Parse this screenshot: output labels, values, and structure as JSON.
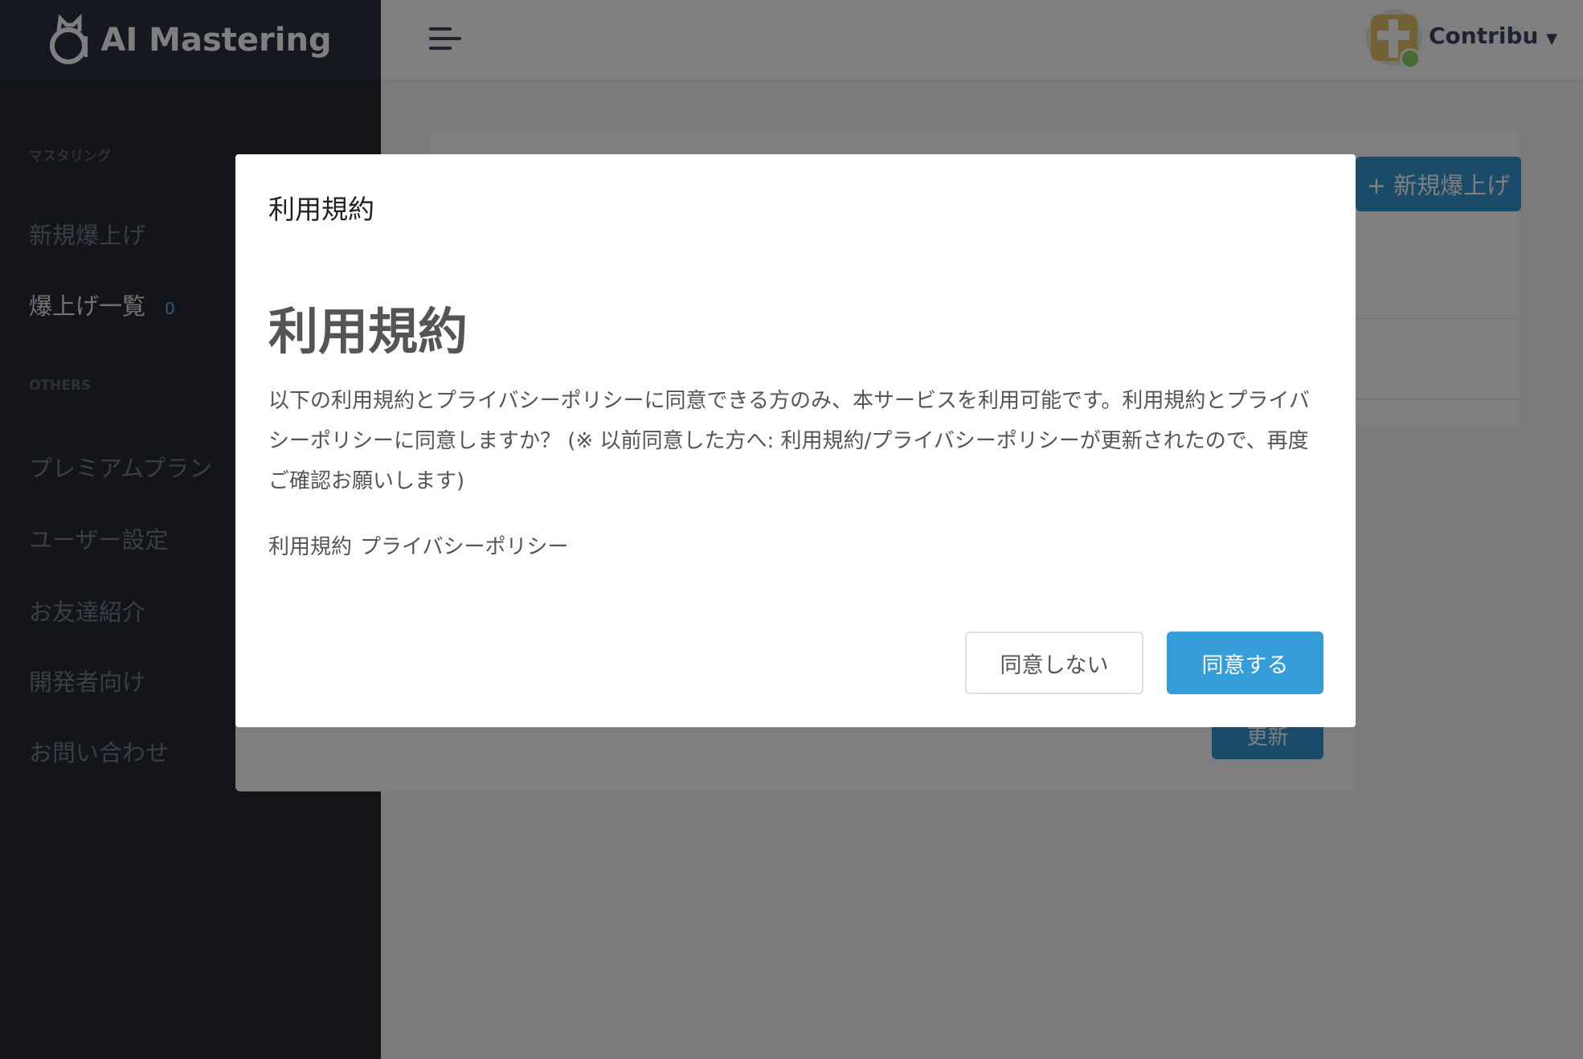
{
  "app": {
    "logo_text": "AI Mastering"
  },
  "sidebar": {
    "section1": "マスタリング",
    "items1": [
      {
        "label": "新規爆上げ"
      },
      {
        "label": "爆上げ一覧",
        "badge": "0"
      }
    ],
    "section2": "OTHERS",
    "items2": [
      {
        "label": "プレミアムプラン"
      },
      {
        "label": "ユーザー設定"
      },
      {
        "label": "お友達紹介"
      },
      {
        "label": "開発者向け"
      },
      {
        "label": "お問い合わせ"
      }
    ]
  },
  "header": {
    "user_name": "Contribu"
  },
  "background": {
    "new_button": "+ 新規爆上げ",
    "update_button": "更新"
  },
  "modal": {
    "title": "利用規約",
    "heading": "利用規約",
    "body": "以下の利用規約とプライバシーポリシーに同意できる方のみ、本サービスを利用可能です。利用規約とプライバシーポリシーに同意しますか？ (※ 以前同意した方へ: 利用規約/プライバシーポリシーが更新されたので、再度ご確認お願いします)",
    "links": [
      "利用規約",
      "プライバシーポリシー"
    ],
    "decline": "同意しない",
    "accept": "同意する"
  },
  "colors": {
    "primary": "#359dd8",
    "sidebar": "#262a33",
    "online": "#8fd46a"
  }
}
